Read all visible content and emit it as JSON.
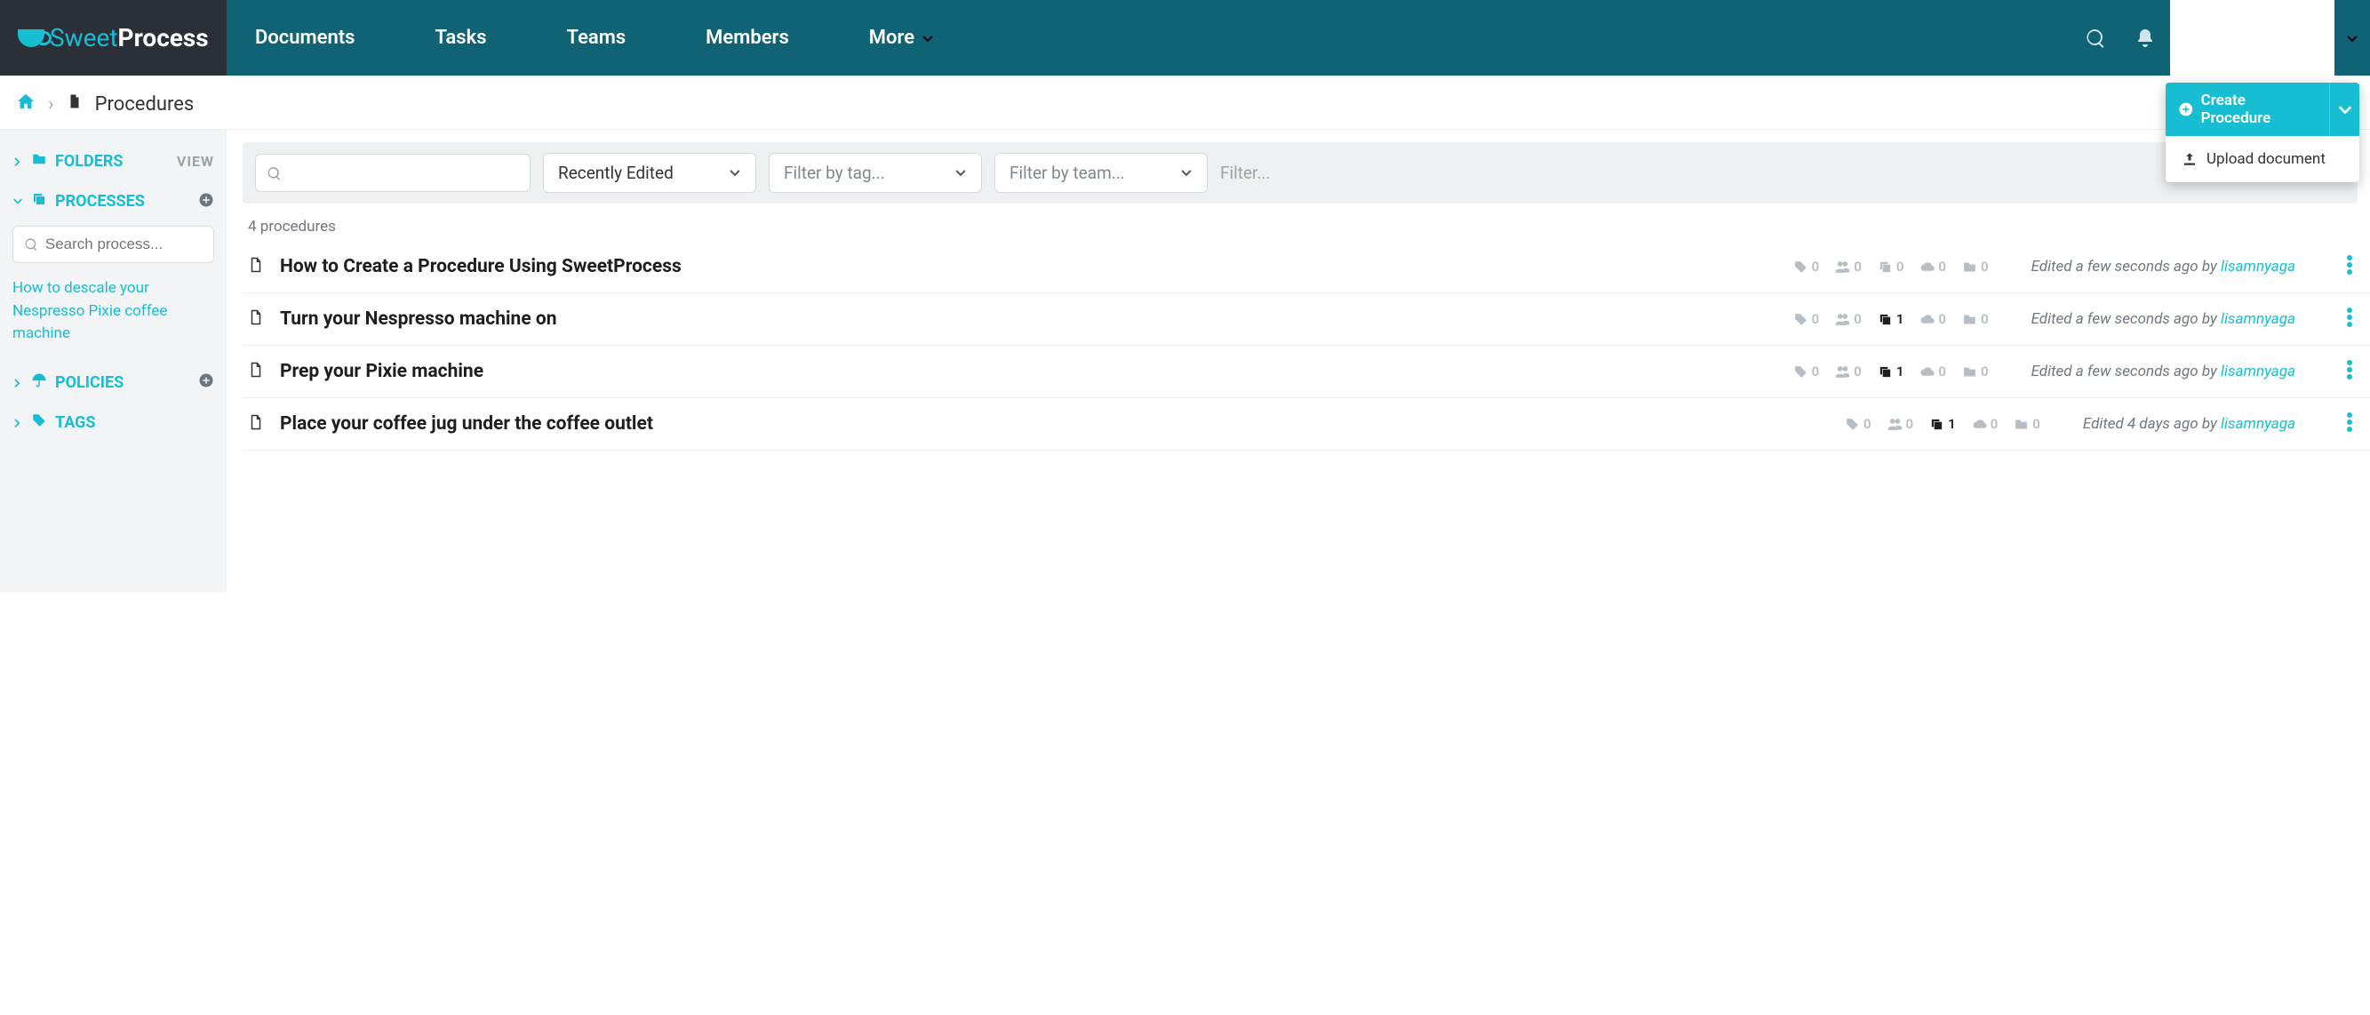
{
  "brand": {
    "accent": "Sweet",
    "bold": "Process"
  },
  "nav": {
    "documents": "Documents",
    "tasks": "Tasks",
    "teams": "Teams",
    "members": "Members",
    "more": "More"
  },
  "breadcrumb": {
    "page": "Procedures"
  },
  "create_menu": {
    "create": "Create Procedure",
    "upload": "Upload document"
  },
  "sidebar": {
    "folders": "FOLDERS",
    "view": "VIEW",
    "processes": "PROCESSES",
    "search_placeholder": "Search process...",
    "doc_link": "How to descale your Nespresso Pixie coffee machine",
    "policies": "POLICIES",
    "tags": "TAGS"
  },
  "filters": {
    "sort": "Recently Edited",
    "tag_placeholder": "Filter by tag...",
    "team_placeholder": "Filter by team...",
    "trunc": "Filter..."
  },
  "count_text": "4 procedures",
  "rows": [
    {
      "title": "How to Create a Procedure Using SweetProcess",
      "tags": "0",
      "members": "0",
      "copies": "0",
      "copies_active": false,
      "clouds": "0",
      "folders": "0",
      "edited": "Edited a few seconds ago by ",
      "user": "lisamnyaga"
    },
    {
      "title": "Turn your Nespresso machine on",
      "tags": "0",
      "members": "0",
      "copies": "1",
      "copies_active": true,
      "clouds": "0",
      "folders": "0",
      "edited": "Edited a few seconds ago by ",
      "user": "lisamnyaga"
    },
    {
      "title": "Prep your Pixie machine",
      "tags": "0",
      "members": "0",
      "copies": "1",
      "copies_active": true,
      "clouds": "0",
      "folders": "0",
      "edited": "Edited a few seconds ago by ",
      "user": "lisamnyaga"
    },
    {
      "title": "Place your coffee jug under the coffee outlet",
      "tags": "0",
      "members": "0",
      "copies": "1",
      "copies_active": true,
      "clouds": "0",
      "folders": "0",
      "edited": "Edited 4 days ago by ",
      "user": "lisamnyaga"
    }
  ]
}
